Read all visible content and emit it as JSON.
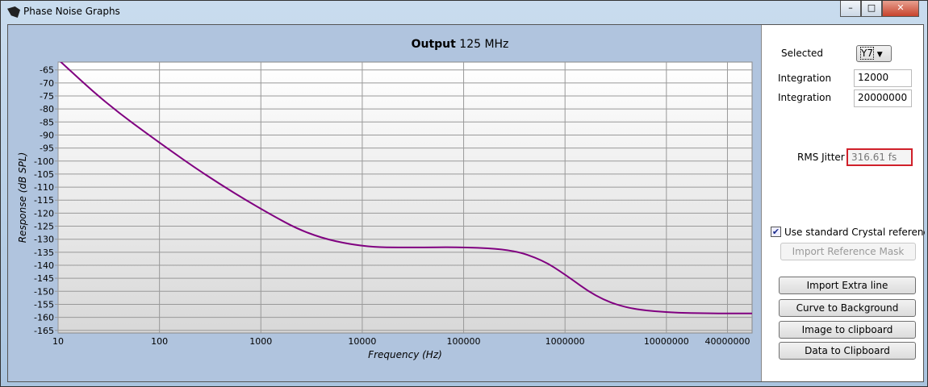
{
  "window": {
    "title": "Phase Noise Graphs",
    "controls": [
      "minimize",
      "maximize",
      "close"
    ]
  },
  "controls": {
    "selected_label": "Selected",
    "selected_value": "Y7",
    "integration_start_label": "Integration",
    "integration_start_value": "12000",
    "integration_stop_label": "Integration",
    "integration_stop_value": "20000000",
    "rms_label": "RMS Jitter",
    "rms_value": "316.61 fs",
    "crystal_checkbox_label": "Use standard Crystal referenc",
    "crystal_checked": true,
    "import_mask": "Import Reference Mask",
    "import_extra": "Import Extra line",
    "curve_bg": "Curve to Background",
    "image_clip": "Image to clipboard",
    "data_clip": "Data to Clipboard",
    "highlight_color": "#d0202a"
  },
  "chart_data": {
    "type": "line",
    "title_bold": "Output",
    "title_rest": "125 MHz",
    "xlabel": "Frequency (Hz)",
    "ylabel": "Response (dB SPL)",
    "xscale": "log",
    "xlim": [
      10,
      70000000
    ],
    "ylim": [
      -166,
      -62
    ],
    "grid": true,
    "xticks": [
      10,
      100,
      1000,
      10000,
      100000,
      1000000,
      10000000,
      40000000
    ],
    "yticks": [
      -65,
      -70,
      -75,
      -80,
      -85,
      -90,
      -95,
      -100,
      -105,
      -110,
      -115,
      -120,
      -125,
      -130,
      -135,
      -140,
      -145,
      -150,
      -155,
      -160,
      -165
    ],
    "line_color": "#800080",
    "series": [
      {
        "x": [
          10,
          30,
          100,
          300,
          1000,
          3000,
          10000,
          30000,
          100000,
          300000,
          600000,
          1000000,
          2000000,
          4000000,
          10000000,
          30000000,
          70000000
        ],
        "y": [
          -61,
          -78,
          -93,
          -106,
          -118.5,
          -128.5,
          -133,
          -133.2,
          -133,
          -134,
          -138,
          -143.5,
          -152,
          -156.5,
          -158.2,
          -158.5,
          -158.5
        ]
      }
    ]
  }
}
